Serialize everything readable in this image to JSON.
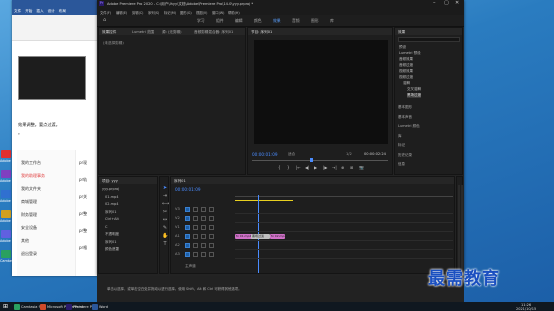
{
  "desktop": {
    "icons": [
      {
        "label": "Adobe",
        "color": "#e03030"
      },
      {
        "label": "Adobe",
        "color": "#8040c0"
      },
      {
        "label": "Adobe",
        "color": "#3070d0"
      },
      {
        "label": "Adobe",
        "color": "#d0a020"
      },
      {
        "label": "Adobe",
        "color": "#6060e0"
      },
      {
        "label": "Camtasia 9",
        "color": "#2aa060"
      }
    ]
  },
  "word": {
    "tabs": [
      "文件",
      "开始",
      "插入",
      "设计",
      "布局"
    ],
    "heading": "效果调整。要点过渡。",
    "note": "。"
  },
  "cms": {
    "topbar": [
      "首页",
      "部门",
      "中心",
      "书"
    ],
    "items": [
      {
        "label": "我的工作台",
        "active": false
      },
      {
        "label": "我的助理事务",
        "active": true
      },
      {
        "label": "我的文件夹",
        "active": false
      },
      {
        "label": "商城管理",
        "active": false
      },
      {
        "label": "财务管理",
        "active": false
      },
      {
        "label": "安全设备",
        "active": false
      },
      {
        "label": "其他",
        "active": false
      },
      {
        "label": "退出登录",
        "active": false
      }
    ],
    "right_items": [
      "pr现",
      "pr轨",
      "pr关",
      "pr整",
      "pr整",
      "pr格"
    ]
  },
  "premiere": {
    "title": "Adobe Premiere Pro 2020 - C:\\用户\\lhyy\\文档\\Adobe\\Premiere Pro\\14.0\\yyy.prproj *",
    "menu": [
      "文件(F)",
      "编辑(E)",
      "剪辑(C)",
      "序列(S)",
      "标记(M)",
      "图形(G)",
      "视图(V)",
      "窗口(W)",
      "帮助(H)"
    ],
    "workspaces": [
      {
        "label": "学习",
        "active": false
      },
      {
        "label": "组件",
        "active": false
      },
      {
        "label": "编辑",
        "active": false
      },
      {
        "label": "颜色",
        "active": false
      },
      {
        "label": "效果",
        "active": true
      },
      {
        "label": "音频",
        "active": false
      },
      {
        "label": "图形",
        "active": false
      },
      {
        "label": "库",
        "active": false
      }
    ],
    "source_tabs": [
      "效果控件",
      "Lumetri 范围",
      "源: (无剪辑)"
    ],
    "source_empty": "(未选择剪辑)",
    "audio_mixer_tab": "音频剪辑混合器: 序列01",
    "program": {
      "tab": "节目: 序列01",
      "timecode_left": "00:00:01:09",
      "fit": "适合",
      "ratio": "1/2",
      "timecode_right": "00:00:02:24"
    },
    "effects": {
      "tab": "效果",
      "items": [
        {
          "label": "预设",
          "level": 0
        },
        {
          "label": "Lumetri 预设",
          "level": 0
        },
        {
          "label": "音频效果",
          "level": 0
        },
        {
          "label": "音频过渡",
          "level": 0
        },
        {
          "label": "视频效果",
          "level": 0
        },
        {
          "label": "视频过渡",
          "level": 0
        },
        {
          "label": "溶解",
          "level": 1
        },
        {
          "label": "交叉溶解",
          "level": 2
        },
        {
          "label": "黑场过渡",
          "level": 2
        }
      ],
      "sections": [
        "基本图形",
        "基本声音",
        "Lumetri 颜色",
        "库",
        "标记",
        "历史记录",
        "信息"
      ]
    },
    "project": {
      "tab": "项目: yyy",
      "items": [
        "yyy.prproj",
        "01.mp4",
        "02.mp4",
        "序列01",
        "Ctrl+Alt",
        "C",
        "不透明度",
        "序列01",
        "颜色遮罩"
      ]
    },
    "timeline": {
      "tab": "序列01",
      "timecode": "00:00:01:09",
      "tracks": [
        "V3",
        "V2",
        "V1",
        "A1",
        "A2",
        "A3"
      ],
      "clips": [
        {
          "label": "fx 01.mp4",
          "color": "#d070c8"
        },
        {
          "label": "黑场过渡",
          "color": "#c0c0c0"
        },
        {
          "label": "fx 02.mp4",
          "color": "#d070c8"
        }
      ],
      "master": "主声道"
    },
    "status": "单击以选择，或单击空白处并拖动以进行选择。使用 Shift、Alt 和 Ctrl 可获得其他选项。"
  },
  "taskbar": {
    "items": [
      "Camtasia 9",
      "Microsoft PowerPoint",
      "Premiere Pro",
      "Word"
    ],
    "clock_time": "11:26",
    "clock_date": "2021/10/15"
  },
  "watermark": "最需教育"
}
